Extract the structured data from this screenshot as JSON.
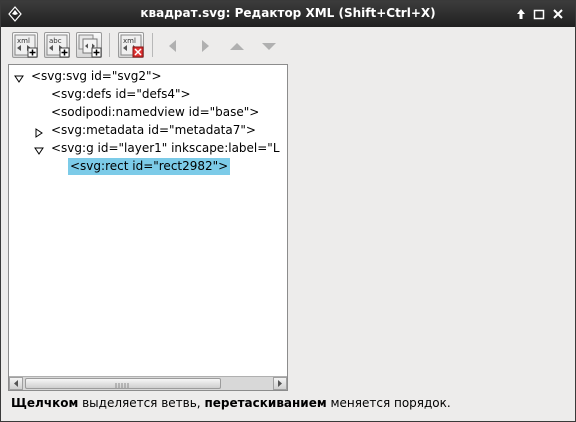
{
  "window": {
    "title": "квадрат.svg: Редактор XML (Shift+Ctrl+X)"
  },
  "titlebar_buttons": [
    "pin-icon",
    "maximize-icon",
    "close-icon"
  ],
  "toolbar": {
    "buttons": [
      {
        "name": "new-element-node-button",
        "icon": "xml-new-element-icon",
        "label": "xml"
      },
      {
        "name": "new-text-node-button",
        "icon": "xml-new-text-icon",
        "label": "abc"
      },
      {
        "name": "duplicate-node-button",
        "icon": "duplicate-node-icon"
      },
      {
        "name": "delete-node-button",
        "icon": "delete-node-icon",
        "label": "xml"
      },
      {
        "name": "unindent-node-button",
        "icon": "arrow-left-icon"
      },
      {
        "name": "indent-node-button",
        "icon": "arrow-right-icon"
      },
      {
        "name": "raise-node-button",
        "icon": "arrow-up-icon"
      },
      {
        "name": "lower-node-button",
        "icon": "arrow-down-icon"
      }
    ]
  },
  "tree": {
    "nodes": [
      {
        "text": "<svg:svg id=\"svg2\">",
        "expander": "expanded"
      },
      {
        "text": "<svg:defs id=\"defs4\">",
        "expander": "none"
      },
      {
        "text": "<sodipodi:namedview id=\"base\">",
        "expander": "none"
      },
      {
        "text": "<svg:metadata id=\"metadata7\">",
        "expander": "collapsed"
      },
      {
        "text": "<svg:g id=\"layer1\" inkscape:label=\"L",
        "expander": "expanded"
      },
      {
        "text": "<svg:rect id=\"rect2982\">",
        "expander": "none",
        "selected": true
      }
    ]
  },
  "status": {
    "part1": "Щелчком",
    "part2": " выделяется ветвь, ",
    "part3": "перетаскиванием",
    "part4": " меняется порядок."
  },
  "colors": {
    "selection": "#7ccbe8",
    "titlebar": "#2a2a2a",
    "background": "#edeceb"
  }
}
